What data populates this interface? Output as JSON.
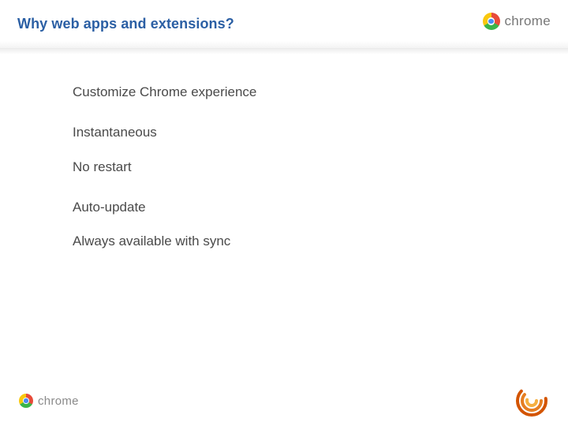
{
  "header": {
    "title": "Why web apps and extensions?",
    "brand_label": "chrome"
  },
  "bullets": [
    "Customize Chrome experience",
    "Instantaneous",
    "No restart",
    "Auto-update",
    "Always available with sync"
  ],
  "footer": {
    "brand_label": "chrome"
  }
}
